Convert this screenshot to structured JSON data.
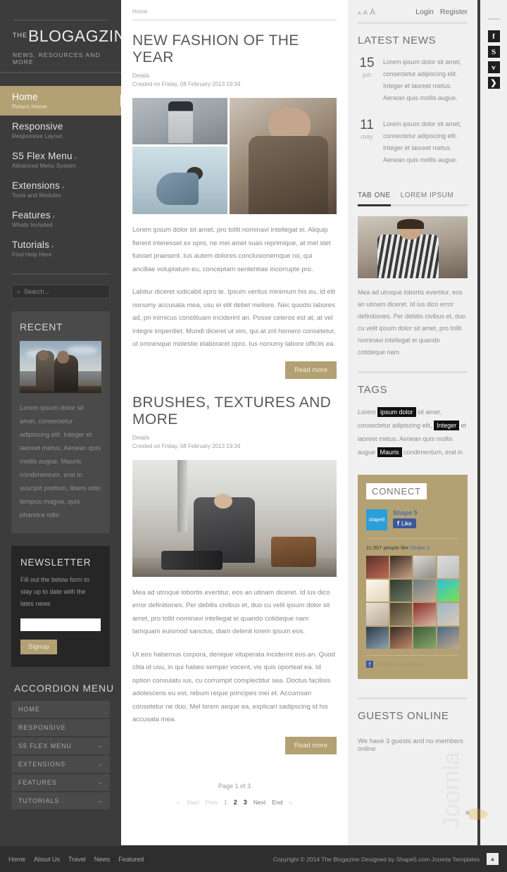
{
  "site": {
    "logo_the": "THE",
    "logo_name": "BLOGAGZINE",
    "tagline": "NEWS, RESOURCES AND MORE"
  },
  "sidebar": {
    "menu": [
      {
        "label": "Home",
        "sub": "Return Home",
        "caret": "",
        "active": true
      },
      {
        "label": "Responsive",
        "sub": "Responsive Layout",
        "caret": "",
        "active": false
      },
      {
        "label": "S5 Flex Menu",
        "sub": "Advanced Menu System",
        "caret": "›",
        "active": false
      },
      {
        "label": "Extensions",
        "sub": "Tools and Modules",
        "caret": "›",
        "active": false
      },
      {
        "label": "Features",
        "sub": "Whats Included",
        "caret": "›",
        "active": false
      },
      {
        "label": "Tutorials",
        "sub": "Find Help Here",
        "caret": "›",
        "active": false
      }
    ],
    "search": {
      "placeholder": "Search...",
      "icon": "search-icon"
    },
    "recent": {
      "title": "RECENT",
      "text": "Lorem ipsum dolor sit amet, consectetur adipiscing elit. Integer et laoreet metus. Aenean quis mollis augue. Mauris condimentum, erat in suscipit pretium, libero odio tempus magna, quis pharetra odio"
    },
    "newsletter": {
      "title": "NEWSLETTER",
      "text": "Fill out the below form to stay up to date with the lates news",
      "input_value": "",
      "button": "Signup"
    },
    "accordion": {
      "title": "ACCORDION MENU",
      "items": [
        {
          "label": "HOME",
          "chevron": ""
        },
        {
          "label": "RESPONSIVE",
          "chevron": ""
        },
        {
          "label": "S5 FLEX MENU",
          "chevron": "⌄"
        },
        {
          "label": "EXTENSIONS",
          "chevron": "⌄"
        },
        {
          "label": "FEATURES",
          "chevron": "⌄"
        },
        {
          "label": "TUTORIALS",
          "chevron": "⌄"
        }
      ]
    }
  },
  "main": {
    "breadcrumb": "Home",
    "articles": [
      {
        "title": "NEW FASHION OF THE YEAR",
        "details_label": "Details",
        "created": "Created on Friday, 08 February 2013 19:34",
        "paragraphs": [
          "Lorem ipsum dolor sit amet, pro tollit nominavi intellegat ei. Aliquip fierent interesset ex opro, ne mei amet suas reprimique, at mel stet fuisset praesent. Ius autem dolores conclusionemque no, qui ancillae voluptatum eu, conceptam sententiae incorrupte pro.",
          "Labitur diceret iudicabit opro te. Ipsum veritus minimum his eu, id elit nonumy accusata mea, usu ei elit debet meliore. Nec quodsi labores ad, pri inimicus constituam inciderint an. Posse celeros est at, at vel integre imperdiet. Mundi diceret ut vim, qui at zril homero consetetur, ut omnesque molestie elaboraret opro. Ius nonumy labore officiis ea."
        ],
        "read_more": "Read more"
      },
      {
        "title": "BRUSHES, TEXTURES AND MORE",
        "details_label": "Details",
        "created": "Created on Friday, 08 February 2013 19:34",
        "paragraphs": [
          "Mea ad utroque lobortis evertitur, eos an utinam diceret. Id ius dico error definitiones. Per debitis civibus et, duo cu velit ipsum dolor sit amet, pro tollit nominavi intellegat ei quando cotideque nam tamquam euismod sanctus, diam delenit lorem ipsum eos.",
          "Ut eos habemus corpora, denique vituperata inciderint eos an. Quod clita id usu, in qui habeo semper vocent, vis quis oporteat ea. Id option consulatu ius, cu corrumpit complectitur sea. Doctus facilisis adolescens eu est, rebum reque principes mei et. Accumsan consetetur ne duo. Mel lorem aeque ea, explicari sadipscing id his accusata mea."
        ],
        "read_more": "Read more"
      }
    ],
    "pagination": {
      "count_label": "Page 1 of 3",
      "start": "Start",
      "prev": "Prev",
      "pages": [
        "1",
        "2",
        "3"
      ],
      "current": "1",
      "next": "Next",
      "end": "End"
    }
  },
  "rightbar": {
    "font_sizes": [
      "A",
      "A",
      "A"
    ],
    "login": "Login",
    "register": "Register",
    "latest_news": {
      "title": "LATEST NEWS",
      "items": [
        {
          "day": "15",
          "month": "jun",
          "text": "Lorem ipsum dolor sit amet, consectetur adipiscing elit. Integer et laoreet metus. Aenean quis mollis augue."
        },
        {
          "day": "11",
          "month": "may",
          "text": "Lorem ipsum dolor sit amet, consectetur adipiscing elit. Integer et laoreet metus. Aenean quis mollis augue."
        }
      ]
    },
    "tabs": {
      "items": [
        "TAB ONE",
        "LOREM IPSUM"
      ],
      "active": "TAB ONE",
      "content": "Mea ad utroque lobortis evertitur, eos an utinam diceret. Id ius dico error definitiones. Per debitis civibus et, duo cu velit ipsum dolor sit amet, pro tollit nominavi intellegat ei quando cotideque nam"
    },
    "tags": {
      "title": "TAGS",
      "parts": [
        {
          "t": "Lorem ",
          "hl": false
        },
        {
          "t": "ipsum dolor",
          "hl": true
        },
        {
          "t": " sit amet, consectetur adipiscing elit, ",
          "hl": false
        },
        {
          "t": "Integer",
          "hl": true
        },
        {
          "t": " et laoreet metus. Aenean quis mollis augue ",
          "hl": false
        },
        {
          "t": "Mauris",
          "hl": true
        },
        {
          "t": " condimentum, erat in",
          "hl": false
        }
      ]
    },
    "connect": {
      "title": "CONNECT",
      "page_name": "Shape 5",
      "logo_text": "shape5",
      "like_label": "Like",
      "count_text": "11,907 people like",
      "count_link": "Shape 5.",
      "footer_text": "Facebook social plugin"
    },
    "guests": {
      "title": "GUESTS ONLINE",
      "text": "We have 3 guests and no members online"
    }
  },
  "social": [
    {
      "name": "facebook-icon",
      "glyph": "f"
    },
    {
      "name": "skype-icon",
      "glyph": "S"
    },
    {
      "name": "vimeo-icon",
      "glyph": "v"
    },
    {
      "name": "rss-icon",
      "glyph": "❯"
    }
  ],
  "footer": {
    "nav": [
      "Home",
      "About Us",
      "Travel",
      "News",
      "Featured"
    ],
    "copyright": "Copyright © 2014 The Blogazine Designed by Shape5.com Joomla Templates",
    "to_top": "▲"
  },
  "colors": {
    "accent": "#b3a173",
    "dark": "#3c3c3c",
    "panel": "#4a4a4a",
    "right_bg": "#f0f0f0"
  }
}
